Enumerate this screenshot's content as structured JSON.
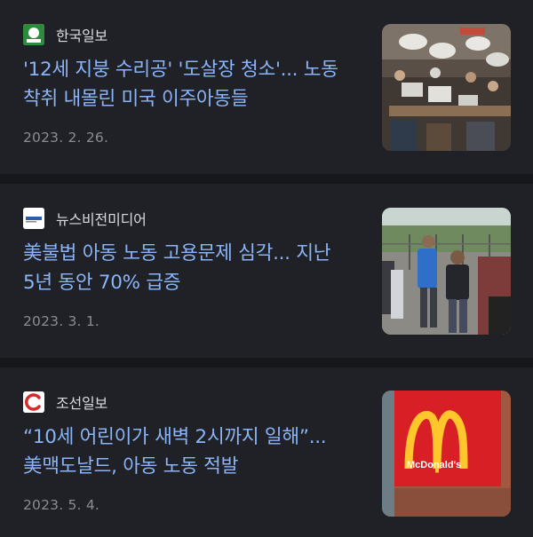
{
  "articles": [
    {
      "source": "한국일보",
      "source_icon": "hankook-ilbo-logo",
      "headline": "'12세 지붕 수리공' '도살장 청소'... 노동 착취 내몰린 미국 이주아동들",
      "date": "2023. 2. 26.",
      "thumbnail": "protest-crowd-with-signs-image"
    },
    {
      "source": "뉴스비전미디어",
      "source_icon": "newsvision-media-logo",
      "headline": "美불법 아동 노동 고용문제 심각... 지난 5년 동안 70% 급증",
      "date": "2023. 3. 1.",
      "thumbnail": "workers-walking-image"
    },
    {
      "source": "조선일보",
      "source_icon": "chosun-ilbo-logo",
      "headline": "“10세 어린이가 새벽 2시까지 일해”... 美맥도날드, 아동 노동 적발",
      "date": "2023. 5. 4.",
      "thumbnail": "mcdonalds-sign-image",
      "thumbnail_sign_text": "McDonald's"
    }
  ],
  "colors": {
    "background": "#16171b",
    "card": "#202126",
    "headline": "#8ab4f8",
    "source_text": "#d9dadf",
    "date_text": "#8b8c92"
  }
}
